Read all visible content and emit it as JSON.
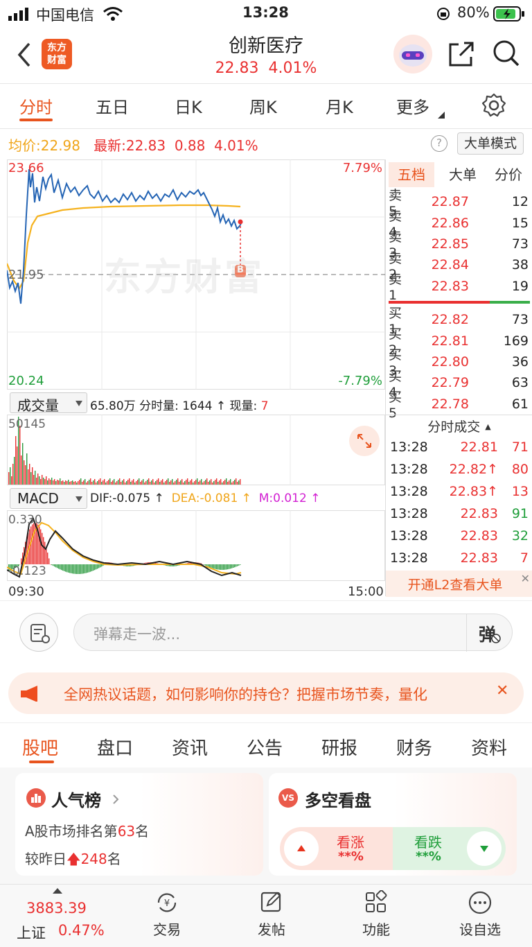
{
  "status": {
    "carrier": "中国电信",
    "time": "13:28",
    "battery": "80%"
  },
  "header": {
    "back_icon": "chevron-left",
    "logo_text_1": "东方",
    "logo_text_2": "财富",
    "title": "创新医疗",
    "price": "22.83",
    "change_pct": "4.01%"
  },
  "period_tabs": [
    {
      "label": "分时"
    },
    {
      "label": "五日"
    },
    {
      "label": "日K"
    },
    {
      "label": "周K"
    },
    {
      "label": "月K"
    },
    {
      "label": "更多"
    }
  ],
  "info_bar": {
    "avg_label": "均价:",
    "avg_value": "22.98",
    "latest_label": "最新:",
    "latest_value": "22.83",
    "change": "0.88",
    "change_pct": "4.01%",
    "help_icon": "?",
    "big_order_mode": "大单模式"
  },
  "chart": {
    "price_high": "23.66",
    "price_mid": "21.95",
    "price_low": "20.24",
    "pct_high": "7.79%",
    "pct_low": "-7.79%",
    "watermark": "东方财富",
    "marker": "B",
    "time_start": "09:30",
    "time_end": "15:00"
  },
  "volume_bar": {
    "selector": "成交量",
    "total": "65.80万",
    "tick_label": "分时量:",
    "tick_value": "1644",
    "now_label": "现量:",
    "now_value": "7",
    "axis_max": "50145"
  },
  "macd_bar": {
    "selector": "MACD",
    "dif": "DIF:-0.075",
    "dea": "DEA:-0.081",
    "m": "M:0.012",
    "axis_top": "0.330",
    "axis_bottom": "-0.123"
  },
  "orderbook": {
    "tabs": [
      "五档",
      "大单",
      "分价"
    ],
    "asks": [
      {
        "label": "卖5",
        "price": "22.87",
        "vol": "12"
      },
      {
        "label": "卖4",
        "price": "22.86",
        "vol": "15"
      },
      {
        "label": "卖3",
        "price": "22.85",
        "vol": "73"
      },
      {
        "label": "卖2",
        "price": "22.84",
        "vol": "38"
      },
      {
        "label": "卖1",
        "price": "22.83",
        "vol": "19"
      }
    ],
    "bids": [
      {
        "label": "买1",
        "price": "22.82",
        "vol": "73"
      },
      {
        "label": "买2",
        "price": "22.81",
        "vol": "169"
      },
      {
        "label": "买3",
        "price": "22.80",
        "vol": "36"
      },
      {
        "label": "买4",
        "price": "22.79",
        "vol": "63"
      },
      {
        "label": "买5",
        "price": "22.78",
        "vol": "61"
      }
    ]
  },
  "trades": {
    "title": "分时成交",
    "rows": [
      {
        "time": "13:28",
        "price": "22.81",
        "vol": "71"
      },
      {
        "time": "13:28",
        "price": "22.82↑",
        "vol": "80"
      },
      {
        "time": "13:28",
        "price": "22.83↑",
        "vol": "13"
      },
      {
        "time": "13:28",
        "price": "22.83",
        "vol": "91"
      },
      {
        "time": "13:28",
        "price": "22.83",
        "vol": "32"
      },
      {
        "time": "13:28",
        "price": "22.83",
        "vol": "7"
      }
    ],
    "l2_banner": "开通L2查看大单"
  },
  "danmu": {
    "placeholder": "弹幕走一波...",
    "button": "弹"
  },
  "notice": {
    "text": "全网热议话题，如何影响你的持仓？把握市场节奏，量化"
  },
  "section_tabs": [
    {
      "label": "股吧"
    },
    {
      "label": "盘口"
    },
    {
      "label": "资讯"
    },
    {
      "label": "公告"
    },
    {
      "label": "研报"
    },
    {
      "label": "财务"
    },
    {
      "label": "资料"
    }
  ],
  "popularity": {
    "title": "人气榜",
    "rank_prefix": "A股市场排名第",
    "rank": "63",
    "rank_suffix": "名",
    "change_prefix": "较昨日",
    "change_value": "248",
    "change_suffix": "名"
  },
  "sentiment": {
    "title": "多空看盘",
    "bull_label": "看涨",
    "bull_value": "**%",
    "bear_label": "看跌",
    "bear_value": "**%"
  },
  "bottom_nav": {
    "index_value": "3883.39",
    "index_name": "上证",
    "index_pct": "0.47%",
    "trade": "交易",
    "post": "发帖",
    "func": "功能",
    "watch": "设自选"
  }
}
